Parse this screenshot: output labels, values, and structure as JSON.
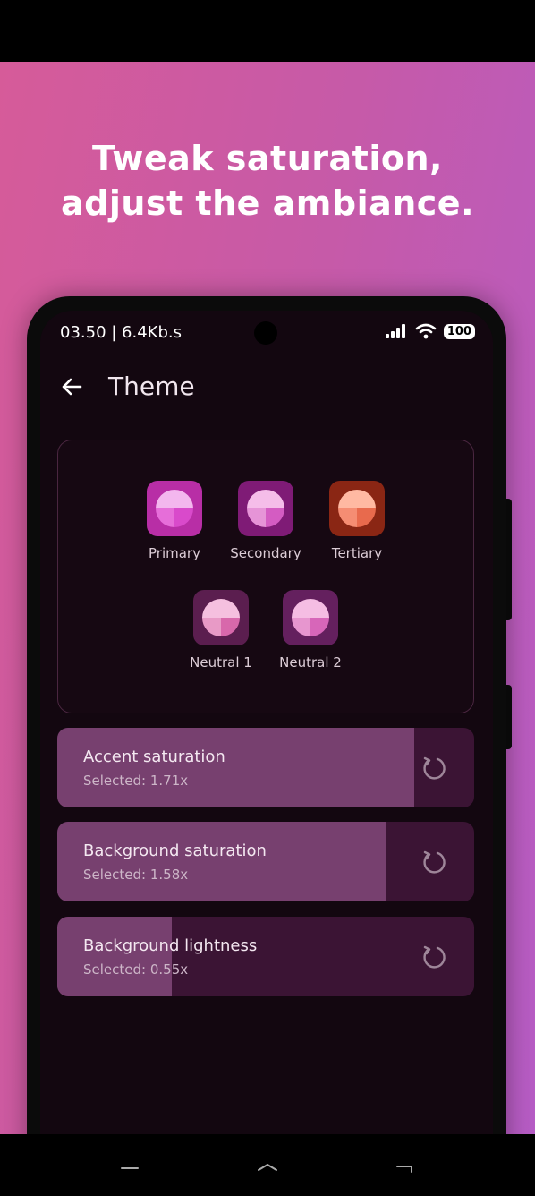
{
  "promo": {
    "headline_line1": "Tweak saturation,",
    "headline_line2": "adjust the ambiance.",
    "background_gradient": [
      "#d65b99",
      "#b65cc5"
    ]
  },
  "status_bar": {
    "left_text": "03.50 | 6.4Kb.s",
    "battery": "100",
    "icons": [
      "signal-icon",
      "wifi-icon",
      "battery-icon"
    ]
  },
  "app_bar": {
    "back_icon": "arrow-left-icon",
    "title": "Theme"
  },
  "palette": [
    {
      "label": "Primary",
      "bg": "#b82ea6",
      "c1": "#f3b7ee",
      "c2": "#e66ed9",
      "c3": "#d94acb"
    },
    {
      "label": "Secondary",
      "bg": "#7f1b76",
      "c1": "#f5bde9",
      "c2": "#e694d7",
      "c3": "#d45cc2"
    },
    {
      "label": "Tertiary",
      "bg": "#8a2614",
      "c1": "#ffb9a2",
      "c2": "#f58d73",
      "c3": "#e86a4d"
    },
    {
      "label": "Neutral 1",
      "bg": "#5b1e4f",
      "c1": "#f5c0df",
      "c2": "#e89ac6",
      "c3": "#d868ab"
    },
    {
      "label": "Neutral 2",
      "bg": "#64205e",
      "c1": "#f5bde3",
      "c2": "#e796cf",
      "c3": "#d766b9"
    }
  ],
  "sliders": [
    {
      "title": "Accent saturation",
      "selected": "Selected: 1.71x",
      "fraction": 0.857
    },
    {
      "title": "Background saturation",
      "selected": "Selected: 1.58x",
      "fraction": 0.79
    },
    {
      "title": "Background lightness",
      "selected": "Selected: 0.55x",
      "fraction": 0.275
    }
  ],
  "navigation": [
    "back-icon",
    "home-icon",
    "recents-icon"
  ],
  "colors": {
    "screen_bg": "#130710",
    "slider_fill": "#77406f",
    "slider_track": "#3b1434"
  }
}
